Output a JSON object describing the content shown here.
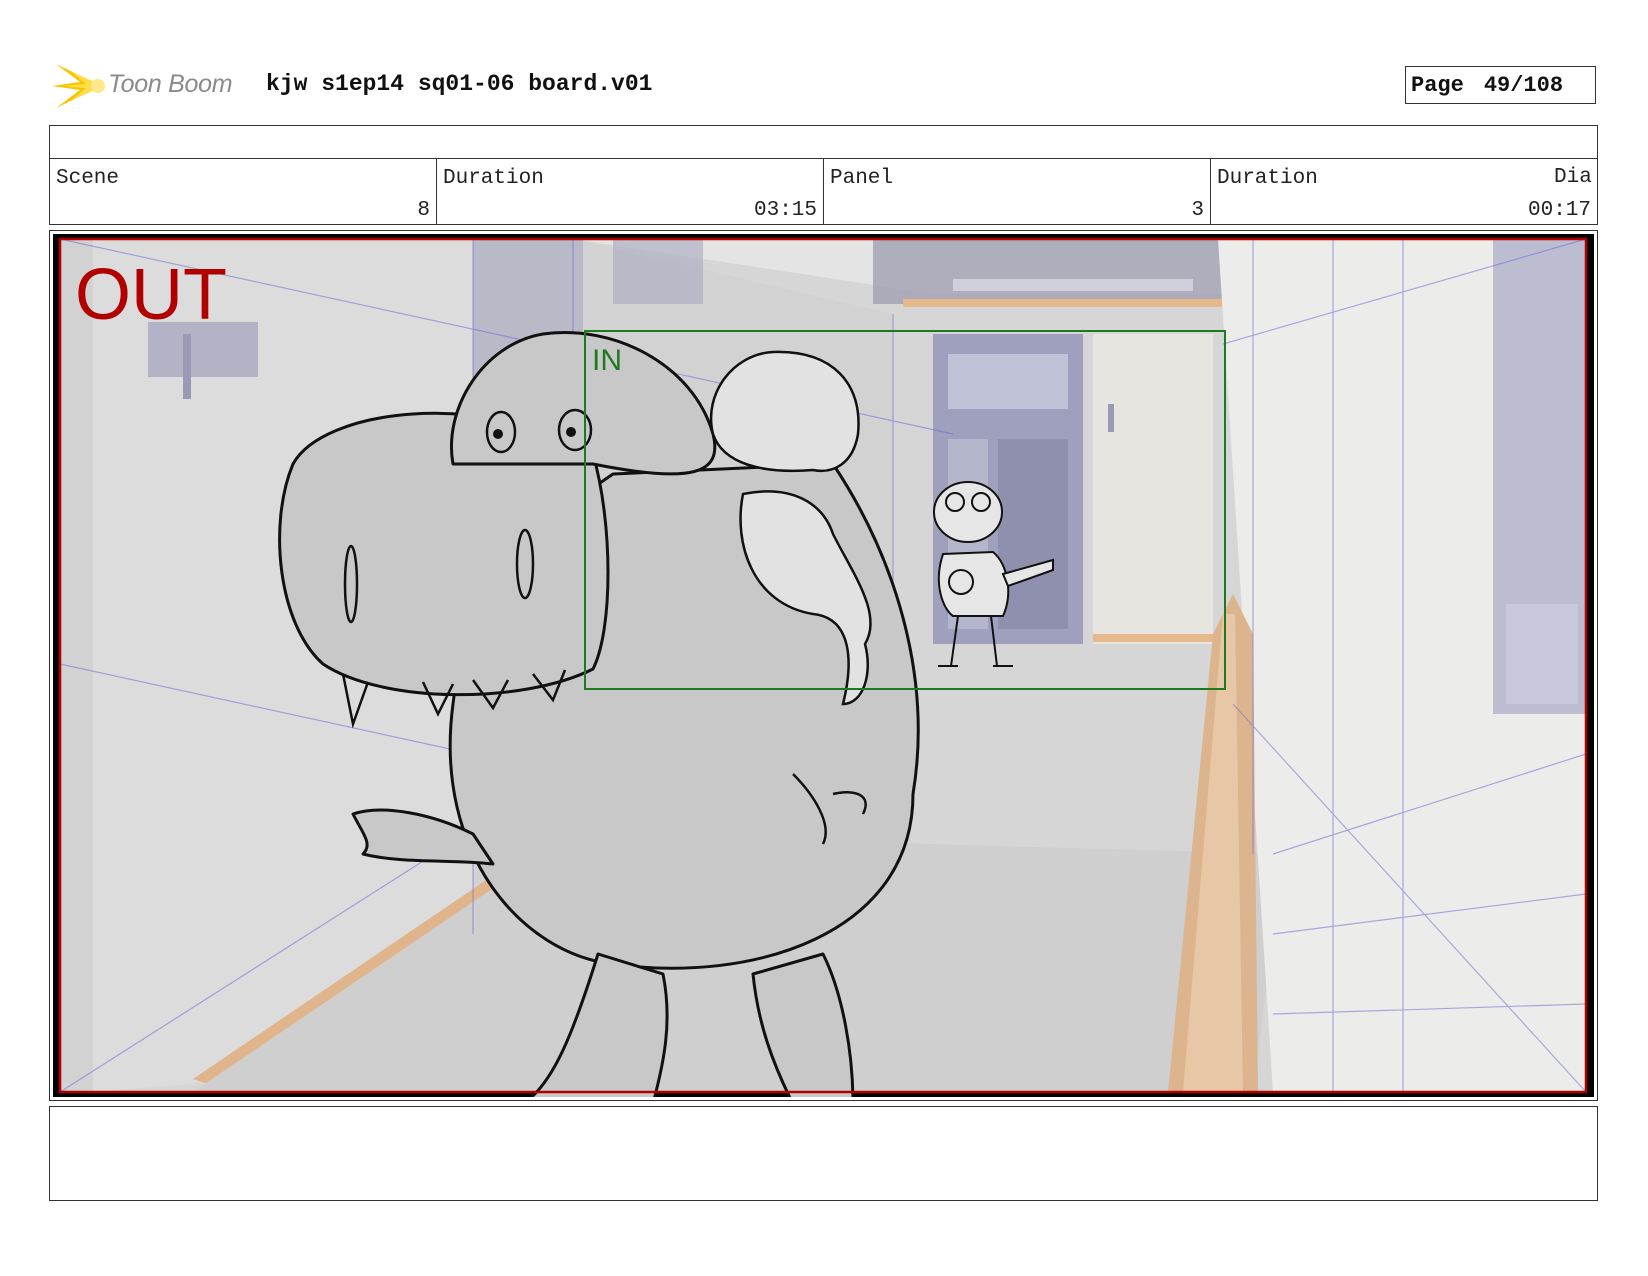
{
  "header": {
    "logo_text": "Toon Boom",
    "title": "kjw s1ep14 sq01-06 board.v01",
    "page_label": "Page",
    "page_number": "49/108"
  },
  "info": {
    "scene_label": "Scene",
    "scene_value": "8",
    "scene_duration_label": "Duration",
    "scene_duration_value": "03:15",
    "panel_label": "Panel",
    "panel_value": "3",
    "panel_duration_label": "Duration",
    "panel_duration_value": "00:17",
    "dialog_label": "Dia"
  },
  "panel": {
    "out_label": "OUT",
    "in_label": "IN"
  },
  "colors": {
    "out_frame": "#b00000",
    "in_frame": "#1e7a1e",
    "logo_accent": "#f7c600"
  }
}
